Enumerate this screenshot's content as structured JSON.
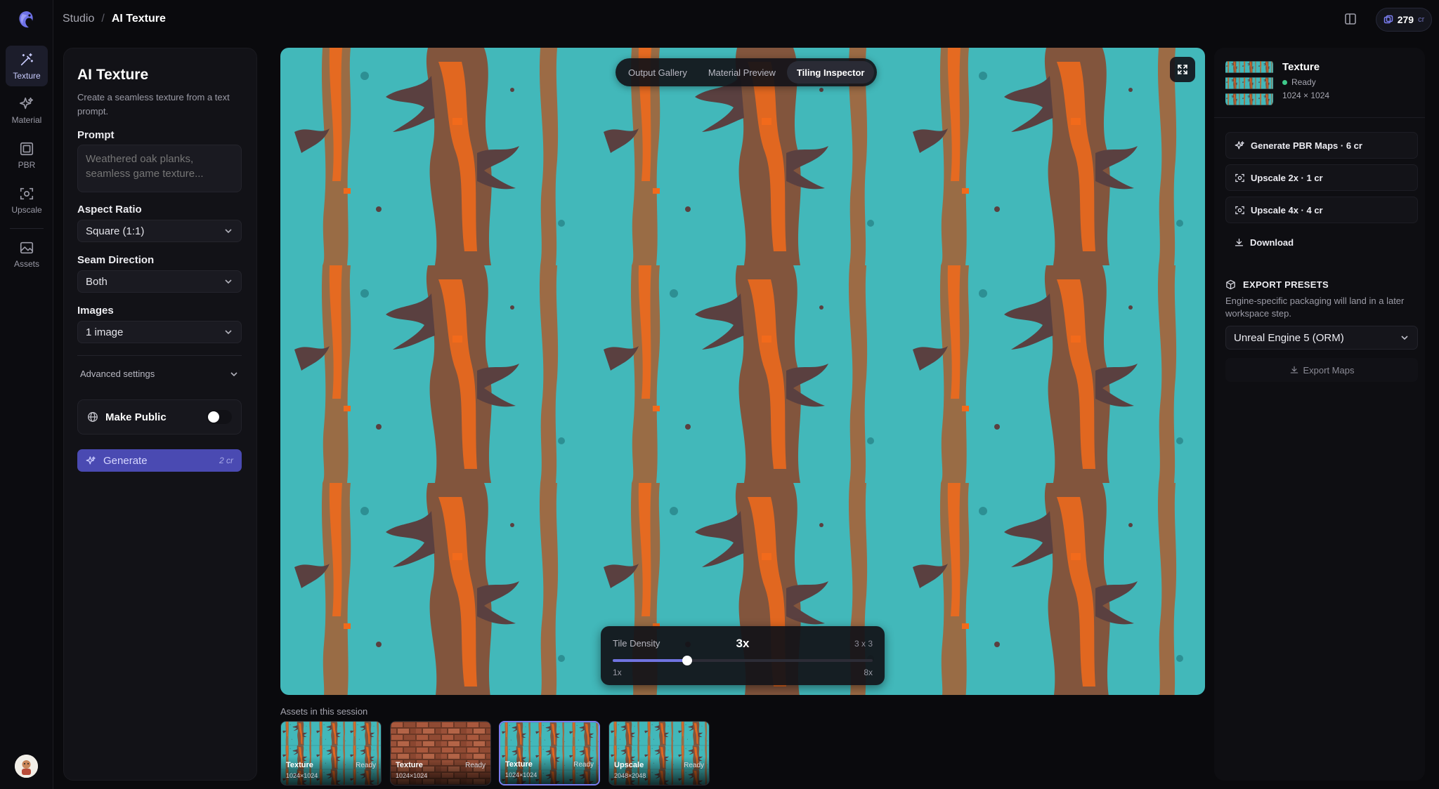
{
  "breadcrumb": {
    "root": "Studio",
    "separator": "/",
    "current": "AI Texture"
  },
  "credits": {
    "amount": "279",
    "unit": "cr"
  },
  "rail": {
    "items": [
      {
        "label": "Texture",
        "icon": "magic-wand-icon",
        "active": true
      },
      {
        "label": "Material",
        "icon": "sparkles-icon",
        "active": false
      },
      {
        "label": "PBR",
        "icon": "layers-icon",
        "active": false
      },
      {
        "label": "Upscale",
        "icon": "scan-icon",
        "active": false
      },
      {
        "label": "Assets",
        "icon": "image-icon",
        "active": false
      }
    ]
  },
  "left_panel": {
    "title": "AI Texture",
    "description": "Create a seamless texture from a text prompt.",
    "prompt_label": "Prompt",
    "prompt_placeholder": "Weathered oak planks, seamless game texture...",
    "aspect_label": "Aspect Ratio",
    "aspect_value": "Square (1:1)",
    "seam_label": "Seam Direction",
    "seam_value": "Both",
    "images_label": "Images",
    "images_value": "1 image",
    "advanced_label": "Advanced settings",
    "public_label": "Make Public",
    "public_enabled": false,
    "generate_label": "Generate",
    "generate_cost": "2 cr"
  },
  "canvas": {
    "tabs": [
      {
        "label": "Output Gallery",
        "active": false
      },
      {
        "label": "Material Preview",
        "active": false
      },
      {
        "label": "Tiling Inspector",
        "active": true
      }
    ],
    "density": {
      "label": "Tile Density",
      "value": "3x",
      "grid": "3 x 3",
      "min_label": "1x",
      "max_label": "8x",
      "min": 1,
      "max": 8,
      "current": 3
    },
    "colors": {
      "base": "#3bb3b6",
      "rust": "#c24a14",
      "bright": "#f26a1b",
      "dark": "#5a4040"
    }
  },
  "assets": {
    "title": "Assets in this session",
    "items": [
      {
        "type": "Texture",
        "status": "Ready",
        "size": "1024×1024",
        "style": "rust",
        "selected": false
      },
      {
        "type": "Texture",
        "status": "Ready",
        "size": "1024×1024",
        "style": "brick",
        "selected": false
      },
      {
        "type": "Texture",
        "status": "Ready",
        "size": "1024×1024",
        "style": "rust",
        "selected": true
      },
      {
        "type": "Upscale",
        "status": "Ready",
        "size": "2048×2048",
        "style": "rust",
        "selected": false
      }
    ]
  },
  "right_panel": {
    "name": "Texture",
    "status": "Ready",
    "dims": "1024 × 1024",
    "actions": [
      {
        "label": "Generate PBR Maps · 6 cr",
        "icon": "sparkles-icon"
      },
      {
        "label": "Upscale 2x · 1 cr",
        "icon": "scan-icon"
      },
      {
        "label": "Upscale 4x · 4 cr",
        "icon": "scan-icon"
      },
      {
        "label": "Download",
        "icon": "download-icon"
      }
    ],
    "export_title": "EXPORT PRESETS",
    "export_desc": "Engine-specific packaging will land in a later workspace step.",
    "export_select": "Unreal Engine 5 (ORM)",
    "export_button": "Export Maps"
  }
}
